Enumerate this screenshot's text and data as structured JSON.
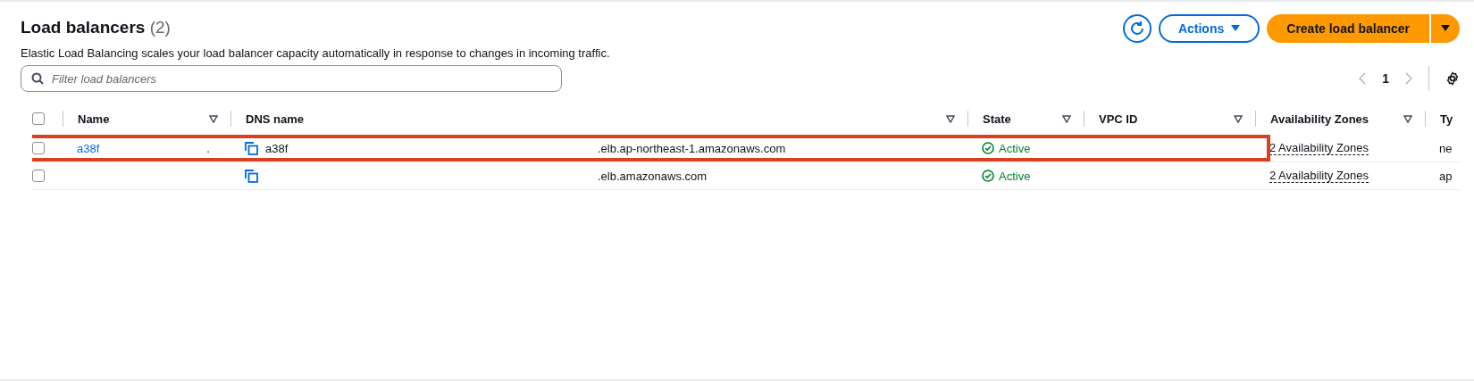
{
  "header": {
    "title": "Load balancers",
    "count": "(2)",
    "description": "Elastic Load Balancing scales your load balancer capacity automatically in response to changes in incoming traffic.",
    "actions": "Actions",
    "create": "Create load balancer"
  },
  "filter": {
    "placeholder": "Filter load balancers"
  },
  "pagination": {
    "page": "1"
  },
  "table": {
    "all_selected": false,
    "columns": [
      {
        "label": "Name",
        "sortable": true
      },
      {
        "label": "DNS name",
        "sortable": true
      },
      {
        "label": "State",
        "sortable": true
      },
      {
        "label": "VPC ID",
        "sortable": true
      },
      {
        "label": "Availability Zones",
        "sortable": true
      },
      {
        "label": "Ty",
        "sortable": false
      }
    ],
    "rows": [
      {
        "selected": false,
        "highlighted": true,
        "name": "a38f",
        "name_tail": ".",
        "dns_prefix": "a38f",
        "dns_suffix": ".elb.ap-northeast-1.amazonaws.com",
        "state": "Active",
        "zones": "2 Availability Zones",
        "type": "ne"
      },
      {
        "selected": false,
        "highlighted": false,
        "name": "",
        "name_tail": "",
        "dns_prefix": "",
        "dns_suffix": ".elb.amazonaws.com",
        "state": "Active",
        "zones": "2 Availability Zones",
        "type": "ap"
      }
    ]
  }
}
